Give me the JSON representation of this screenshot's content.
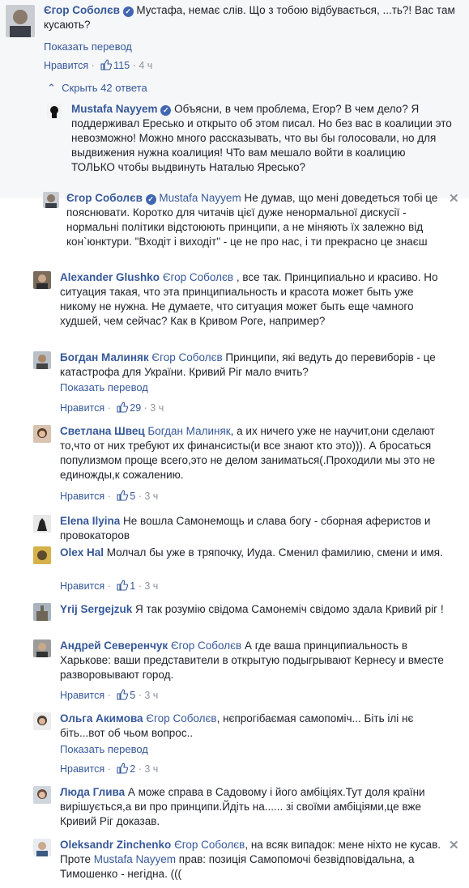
{
  "c1": {
    "author": "Єгор Соболєв",
    "text": "Мустафа, немає слів. Що з тобою відбувається, ...ть?! Вас там кусають?",
    "translate": "Показать перевод",
    "like": "Нравится",
    "count": "115",
    "time": "4 ч"
  },
  "hide_replies": "Скрыть 42 ответа",
  "r1": {
    "author": "Mustafa Nayyem",
    "text": "Объясни, в чем проблема, Егор? В чем дело? Я поддерживал Ересько и открыто об этом писал. Но без вас в коалиции это невозможно! Можно много рассказывать, что вы бы голосовали, но для выдвижения нужна коалиция! ЧТо вам мешало войти в коалицию ТОЛЬКО чтобы выдвинуть Наталью Яресько?"
  },
  "r2": {
    "author": "Єгор Соболєв",
    "mention": "Mustafa Nayyem",
    "text": " Не думав, що мені доведеться тобі це пояснювати. Коротко для читачів цієї дуже ненормальної дискусії - нормальні політики відстоюють принципи, а не міняють їх залежно від кон`юнктури. \"Входіт і виходіт\" - це не про нас, і ти прекрасно це знаєш"
  },
  "r3": {
    "author": "Alexander Glushko",
    "mention": "Єгор Соболєв",
    "text": " , все так. Принципиально и красиво. Но ситуация такая, что эта принципиальность и красота может быть уже никому не нужна. Не думаете, что ситуация может быть еще чамного худшей, чем сейчас? Как в Кривом Роге, например?"
  },
  "r4": {
    "author": "Богдан Малиняк",
    "mention": "Єгор Соболєв",
    "text": " Принципи, які ведуть до перевиборів - це катастрофа для України. Кривий Ріг мало вчить?",
    "translate": "Показать перевод",
    "like": "Нравится",
    "count": "29",
    "time": "3 ч"
  },
  "r5": {
    "author": "Светлана Швец",
    "mention": "Богдан Малиняк",
    "text": ", а их ничего уже не научит,они сделают то,что от них требуют их финансисты(и все знают кто это))). А бросаться популизмом проще всего,это не делом заниматься(.Проходили мы это не единожды,к сожалению.",
    "like": "Нравится",
    "count": "5",
    "time": "3 ч"
  },
  "r6": {
    "author": "Elena Ilyina",
    "text": " Не вошла Самонемощь и слава богу - сборная аферистов и провокаторов"
  },
  "r7": {
    "author": "Olex Hal",
    "text": " Молчал бы уже в тряпочку, Иуда. Сменил фамилию, смени и имя.",
    "like": "Нравится",
    "count": "1",
    "time": "3 ч"
  },
  "r8": {
    "author": "Yrij Sergejzuk",
    "text": " Я так розумію свідома Самонеміч свідомо здала Кривий ріг !"
  },
  "r9": {
    "author": "Андрей Северенчук",
    "mention": "Єгор Соболєв",
    "text": " А где ваша принципиальность в Харькове: ваши представители в открытую подыгрывают Кернесу и вместе разворовывают город.",
    "like": "Нравится",
    "count": "5",
    "time": "3 ч"
  },
  "r10": {
    "author": "Ольга Акимова",
    "mention": "Єгор Соболєв",
    "text": ", нєпрогібаємая самопоміч... Біть ілі нє біть...вот об чьом вопрос..",
    "translate": "Показать перевод",
    "like": "Нравится",
    "count": "2",
    "time": "3 ч"
  },
  "r11": {
    "author": "Люда Глива",
    "text": " А може справа в Садовому і його амбіціях.Тут доля країни вирішується,а ви про принципи.Йдіть на...... зі своїми амбіціями,це вже Кривий Ріг доказав."
  },
  "r12": {
    "author": "Oleksandr Zinchenko",
    "mention": "Єгор Соболєв",
    "text1": ", на всяк випадок: мене ніхто не кусав. Проте ",
    "mention2": "Mustafa Nayyem",
    "text2": " прав: позиція Самопомочі безвідповідальна, а Тимошенко - негідна. ((("
  },
  "colors": {
    "link": "#365899",
    "meta": "#90949c",
    "bg_grey": "#f6f7f9"
  }
}
